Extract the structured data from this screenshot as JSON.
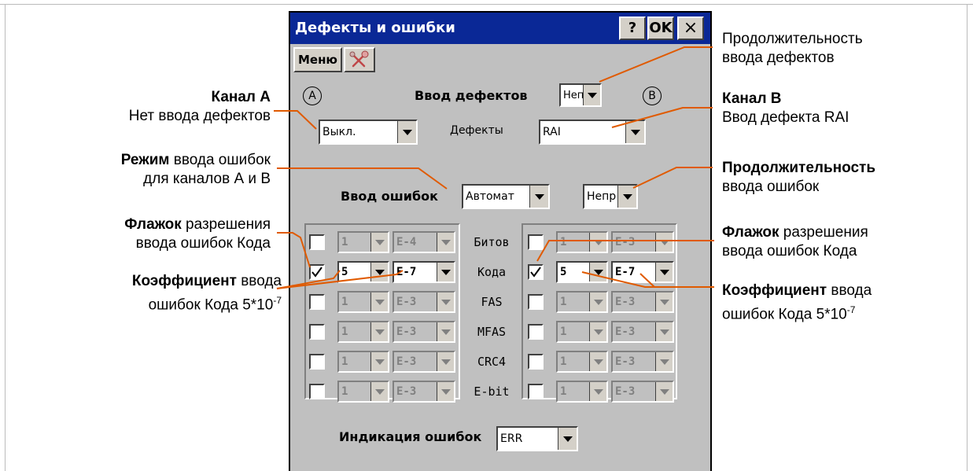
{
  "dialog": {
    "title": "Дефекты и ошибки",
    "help_label": "?",
    "ok_label": "OK",
    "close_label": "×",
    "menu_label": "Меню",
    "tool_icon": "tools-icon"
  },
  "defects": {
    "input_label": "Ввод дефектов",
    "duration_value": "Непр",
    "channel_a_marker": "A",
    "channel_b_marker": "B",
    "defects_label": "Дефекты",
    "channel_a_value": "Выкл.",
    "channel_b_value": "RAI"
  },
  "errors": {
    "input_label": "Ввод ошибок",
    "mode_value": "Автомат",
    "duration_value": "Непр",
    "indication_label": "Индикация ошибок",
    "indication_value": "ERR"
  },
  "error_rows": [
    {
      "name": "Битов",
      "a_checked": false,
      "a_coef": "1",
      "a_exp": "E-4",
      "a_enabled": false,
      "b_checked": false,
      "b_coef": "1",
      "b_exp": "E-3",
      "b_enabled": false
    },
    {
      "name": "Кода",
      "a_checked": true,
      "a_coef": "5",
      "a_exp": "E-7",
      "a_enabled": true,
      "b_checked": true,
      "b_coef": "5",
      "b_exp": "E-7",
      "b_enabled": true
    },
    {
      "name": "FAS",
      "a_checked": false,
      "a_coef": "1",
      "a_exp": "E-3",
      "a_enabled": false,
      "b_checked": false,
      "b_coef": "1",
      "b_exp": "E-3",
      "b_enabled": false
    },
    {
      "name": "MFAS",
      "a_checked": false,
      "a_coef": "1",
      "a_exp": "E-3",
      "a_enabled": false,
      "b_checked": false,
      "b_coef": "1",
      "b_exp": "E-3",
      "b_enabled": false
    },
    {
      "name": "CRC4",
      "a_checked": false,
      "a_coef": "1",
      "a_exp": "E-3",
      "a_enabled": false,
      "b_checked": false,
      "b_coef": "1",
      "b_exp": "E-3",
      "b_enabled": false
    },
    {
      "name": "E-bit",
      "a_checked": false,
      "a_coef": "1",
      "a_exp": "E-3",
      "a_enabled": false,
      "b_checked": false,
      "b_coef": "1",
      "b_exp": "E-3",
      "b_enabled": false
    }
  ],
  "annotations": {
    "left": {
      "channel_a_bold": "Канал А",
      "channel_a_text": "Нет ввода дефектов",
      "mode_bold": "Режим",
      "mode_text1": " ввода ошибок",
      "mode_text2": "для каналов А и В",
      "flag_bold": "Флажок",
      "flag_text1": " разрешения",
      "flag_text2": "ввода ошибок Кода",
      "coef_bold": "Коэффициент",
      "coef_text1": " ввода",
      "coef_text2": "ошибок Кода 5*10",
      "coef_exp": "-7"
    },
    "right": {
      "duration_defects1": "Продолжительность",
      "duration_defects2": "ввода дефектов",
      "channel_b_bold": "Канал В",
      "channel_b_text": "Ввод дефекта RAI",
      "duration_errors_bold": "Продолжительность",
      "duration_errors_text": "ввода ошибок",
      "flag_bold": "Флажок",
      "flag_text1": " разрешения",
      "flag_text2": "ввода ошибок Кода",
      "coef_bold": "Коэффициент",
      "coef_text1": " ввода",
      "coef_text2": "ошибок Кода 5*10",
      "coef_exp": "-7"
    }
  }
}
